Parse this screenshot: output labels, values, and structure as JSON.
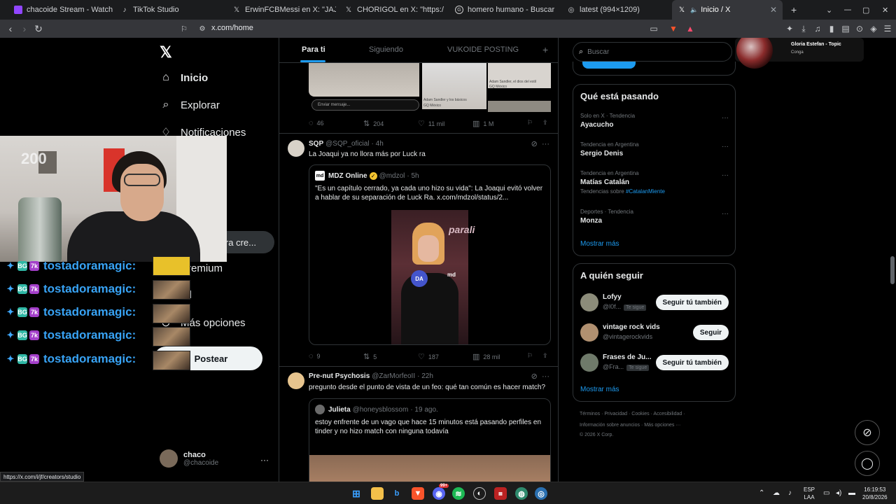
{
  "browser": {
    "tabs": [
      {
        "label": "chacoide Stream - Watch Live o",
        "icon": "twitch-icon",
        "icon_color": "#9146ff"
      },
      {
        "label": "TikTok Studio",
        "icon": "tiktok-icon",
        "icon_color": "#ffffff"
      },
      {
        "label": "ErwinFCBMessi en X: \"JAJAJAJA e",
        "icon": "x-icon",
        "icon_color": "#ffffff"
      },
      {
        "label": "CHORIGOL en X: \"https://t.co/ftih",
        "icon": "x-icon",
        "icon_color": "#ffffff"
      },
      {
        "label": "homero humano - Buscar con Goog",
        "icon": "google-icon",
        "icon_color": "#ffffff"
      },
      {
        "label": "latest (994×1209)",
        "icon": "globe-icon",
        "icon_color": "#cccccc"
      },
      {
        "label": "Inicio / X",
        "icon": "x-icon",
        "icon_color": "#ffffff",
        "active": true
      }
    ],
    "url": "x.com/home",
    "status_url": "https://x.com/i/jf/creators/studio"
  },
  "nav": {
    "items": [
      {
        "label": "Inicio",
        "icon": "home-icon"
      },
      {
        "label": "Explorar",
        "icon": "search-icon"
      },
      {
        "label": "Notificaciones",
        "icon": "bell-icon"
      },
      {
        "label": "Premium",
        "icon": "x-premium-icon"
      },
      {
        "label": "rfil",
        "icon": "person-icon"
      },
      {
        "label": "Más opciones",
        "icon": "more-circle-icon"
      }
    ],
    "partial_pill": "ra cre...",
    "post_button": "Postear",
    "profile_name": "chaco",
    "profile_handle": "@chacoide",
    "more": "···"
  },
  "stream": {
    "counter": "200",
    "chat_user": "tostadoramagic:"
  },
  "timeline": {
    "tabs": [
      "Para ti",
      "Siguiendo",
      "VUKOIDE POSTING"
    ],
    "prev": {
      "input_placeholder": "Enviar mensaje...",
      "caption1": "Adam Sandler y los básicos",
      "caption2": "Adam Sandler, el dios del estil",
      "source": "GQ México",
      "stats": {
        "replies": "46",
        "reposts": "204",
        "likes": "11 mil",
        "views": "1 M"
      }
    },
    "tweet1": {
      "name": "SQP",
      "handle": "@SQP_oficial",
      "time": "· 4h",
      "text": "La Joaqui ya no llora más por Luck ra",
      "quote": {
        "logo": "md",
        "name": "MDZ Online",
        "handle": "@mdzol",
        "time": "· 5h",
        "text": "\"Es un capítulo cerrado, ya cada uno hizo su vida\": La Joaqui evitó volver a hablar de su separación de Luck Ra.  x.com/mdzol/status/2...",
        "img_brand": "parali",
        "img_mic": "DA",
        "img_md": "md"
      },
      "stats": {
        "replies": "9",
        "reposts": "5",
        "likes": "187",
        "views": "28 mil"
      }
    },
    "tweet2": {
      "name": "Pre-nut Psychosis",
      "handle": "@ZarMorfeoII",
      "time": "· 22h",
      "text": "pregunto desde el punto de vista de un feo: qué tan común es hacer match?",
      "quote": {
        "name": "Julieta",
        "handle": "@honeysblossom",
        "time": "· 19 ago.",
        "text": "estoy enfrente de un vago que hace 15 minutos está pasando perfiles en tinder y no hizo match con ninguna todavía"
      }
    }
  },
  "right": {
    "search_placeholder": "Buscar",
    "music": {
      "title": "Gloria Estefan - Topic",
      "subtitle": "Conga"
    },
    "trends_title": "Qué está pasando",
    "trends": [
      {
        "context": "Solo en X · Tendencia",
        "name": "Ayacucho"
      },
      {
        "context": "Tendencia en Argentina",
        "name": "Sergio Denis"
      },
      {
        "context": "Tendencia en Argentina",
        "name": "Matías Catalán",
        "sub": "Tendencias sobre ",
        "sub_tag": "#CatalanMiente"
      },
      {
        "context": "Deportes · Tendencia",
        "name": "Monza"
      }
    ],
    "show_more": "Mostrar más",
    "follow_title": "A quién seguir",
    "follow": [
      {
        "name": "Lofyy",
        "handle": "@l0f...",
        "tag": "Te sigue",
        "button": "Seguir tú también"
      },
      {
        "name": "vintage rock vids",
        "handle": "@vintagerockvids",
        "tag": "",
        "button": "Seguir"
      },
      {
        "name": "Frases de Ju...",
        "handle": "@Fra...",
        "tag": "Te sigue",
        "button": "Seguir tú también"
      }
    ],
    "footer_line1": "Términos  ·  Privacidad  ·  Cookies  ·  Accesibilidad  ·",
    "footer_line2": "Información sobre anuncios  ·  Más opciones ···",
    "footer_line3": "© 2026 X Corp."
  },
  "taskbar": {
    "lang": "ESP",
    "lang2": "LAA",
    "time": "16:19:53",
    "date": "20/8/2026",
    "badge": "99+"
  },
  "colors": {
    "accent": "#1d9bf0",
    "chat": "#38a3f5"
  }
}
